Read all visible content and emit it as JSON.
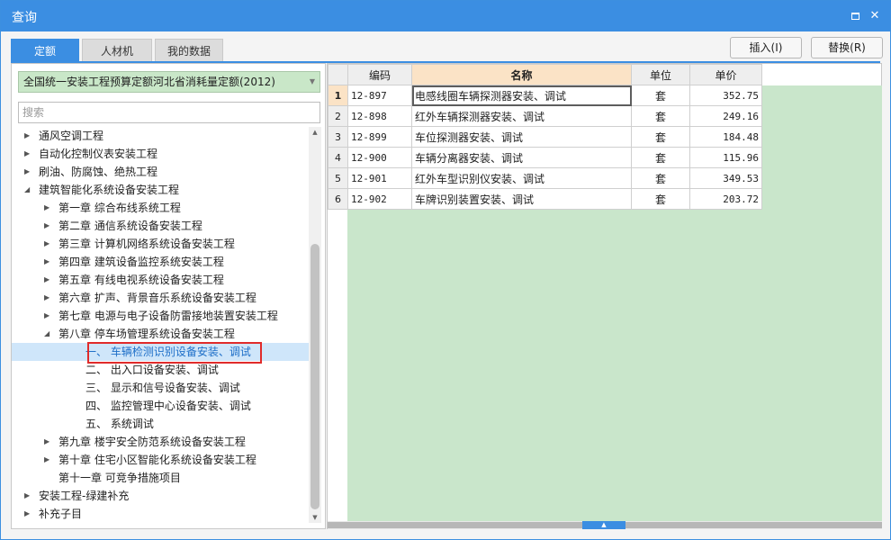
{
  "window": {
    "title": "查询"
  },
  "tabs": [
    {
      "label": "定额",
      "active": true
    },
    {
      "label": "人材机",
      "active": false
    },
    {
      "label": "我的数据",
      "active": false
    }
  ],
  "toolbar": {
    "insert_label": "插入(I)",
    "replace_label": "替换(R)"
  },
  "left_panel": {
    "library_select": "全国统一安装工程预算定额河北省消耗量定额(2012)",
    "search_placeholder": "搜索",
    "tree": [
      {
        "label": "通风空调工程",
        "level": 0,
        "toggle": "collapsed"
      },
      {
        "label": "自动化控制仪表安装工程",
        "level": 0,
        "toggle": "collapsed"
      },
      {
        "label": "刷油、防腐蚀、绝热工程",
        "level": 0,
        "toggle": "collapsed"
      },
      {
        "label": "建筑智能化系统设备安装工程",
        "level": 0,
        "toggle": "expanded"
      },
      {
        "label": "第一章 综合布线系统工程",
        "level": 1,
        "toggle": "collapsed"
      },
      {
        "label": "第二章 通信系统设备安装工程",
        "level": 1,
        "toggle": "collapsed"
      },
      {
        "label": "第三章 计算机网络系统设备安装工程",
        "level": 1,
        "toggle": "collapsed"
      },
      {
        "label": "第四章 建筑设备监控系统安装工程",
        "level": 1,
        "toggle": "collapsed"
      },
      {
        "label": "第五章 有线电视系统设备安装工程",
        "level": 1,
        "toggle": "collapsed"
      },
      {
        "label": "第六章 扩声、背景音乐系统设备安装工程",
        "level": 1,
        "toggle": "collapsed"
      },
      {
        "label": "第七章 电源与电子设备防雷接地装置安装工程",
        "level": 1,
        "toggle": "collapsed"
      },
      {
        "label": "第八章 停车场管理系统设备安装工程",
        "level": 1,
        "toggle": "expanded"
      },
      {
        "label": "一、  车辆检测识别设备安装、调试",
        "level": 2,
        "toggle": "none",
        "selected": true
      },
      {
        "label": "二、  出入口设备安装、调试",
        "level": 2,
        "toggle": "none"
      },
      {
        "label": "三、  显示和信号设备安装、调试",
        "level": 2,
        "toggle": "none"
      },
      {
        "label": "四、  监控管理中心设备安装、调试",
        "level": 2,
        "toggle": "none"
      },
      {
        "label": "五、  系统调试",
        "level": 2,
        "toggle": "none"
      },
      {
        "label": "第九章 楼宇安全防范系统设备安装工程",
        "level": 1,
        "toggle": "collapsed"
      },
      {
        "label": "第十章 住宅小区智能化系统设备安装工程",
        "level": 1,
        "toggle": "collapsed"
      },
      {
        "label": "第十一章 可竞争措施项目",
        "level": 1,
        "toggle": "none"
      },
      {
        "label": "安装工程-绿建补充",
        "level": 0,
        "toggle": "collapsed"
      },
      {
        "label": "补充子目",
        "level": 0,
        "toggle": "collapsed"
      }
    ]
  },
  "grid": {
    "headers": {
      "code": "编码",
      "name": "名称",
      "unit": "单位",
      "price": "单价"
    },
    "rows": [
      {
        "no": "1",
        "code": "12-897",
        "name": "电感线圈车辆探测器安装、调试",
        "unit": "套",
        "price": "352.75"
      },
      {
        "no": "2",
        "code": "12-898",
        "name": "红外车辆探测器安装、调试",
        "unit": "套",
        "price": "249.16"
      },
      {
        "no": "3",
        "code": "12-899",
        "name": "车位探测器安装、调试",
        "unit": "套",
        "price": "184.48"
      },
      {
        "no": "4",
        "code": "12-900",
        "name": "车辆分离器安装、调试",
        "unit": "套",
        "price": "115.96"
      },
      {
        "no": "5",
        "code": "12-901",
        "name": "红外车型识别仪安装、调试",
        "unit": "套",
        "price": "349.53"
      },
      {
        "no": "6",
        "code": "12-902",
        "name": "车牌识别装置安装、调试",
        "unit": "套",
        "price": "203.72"
      }
    ]
  },
  "colors": {
    "accent": "#3b8ee2",
    "green_area": "#c9e6cb",
    "highlight_box": "#e02b2b"
  }
}
